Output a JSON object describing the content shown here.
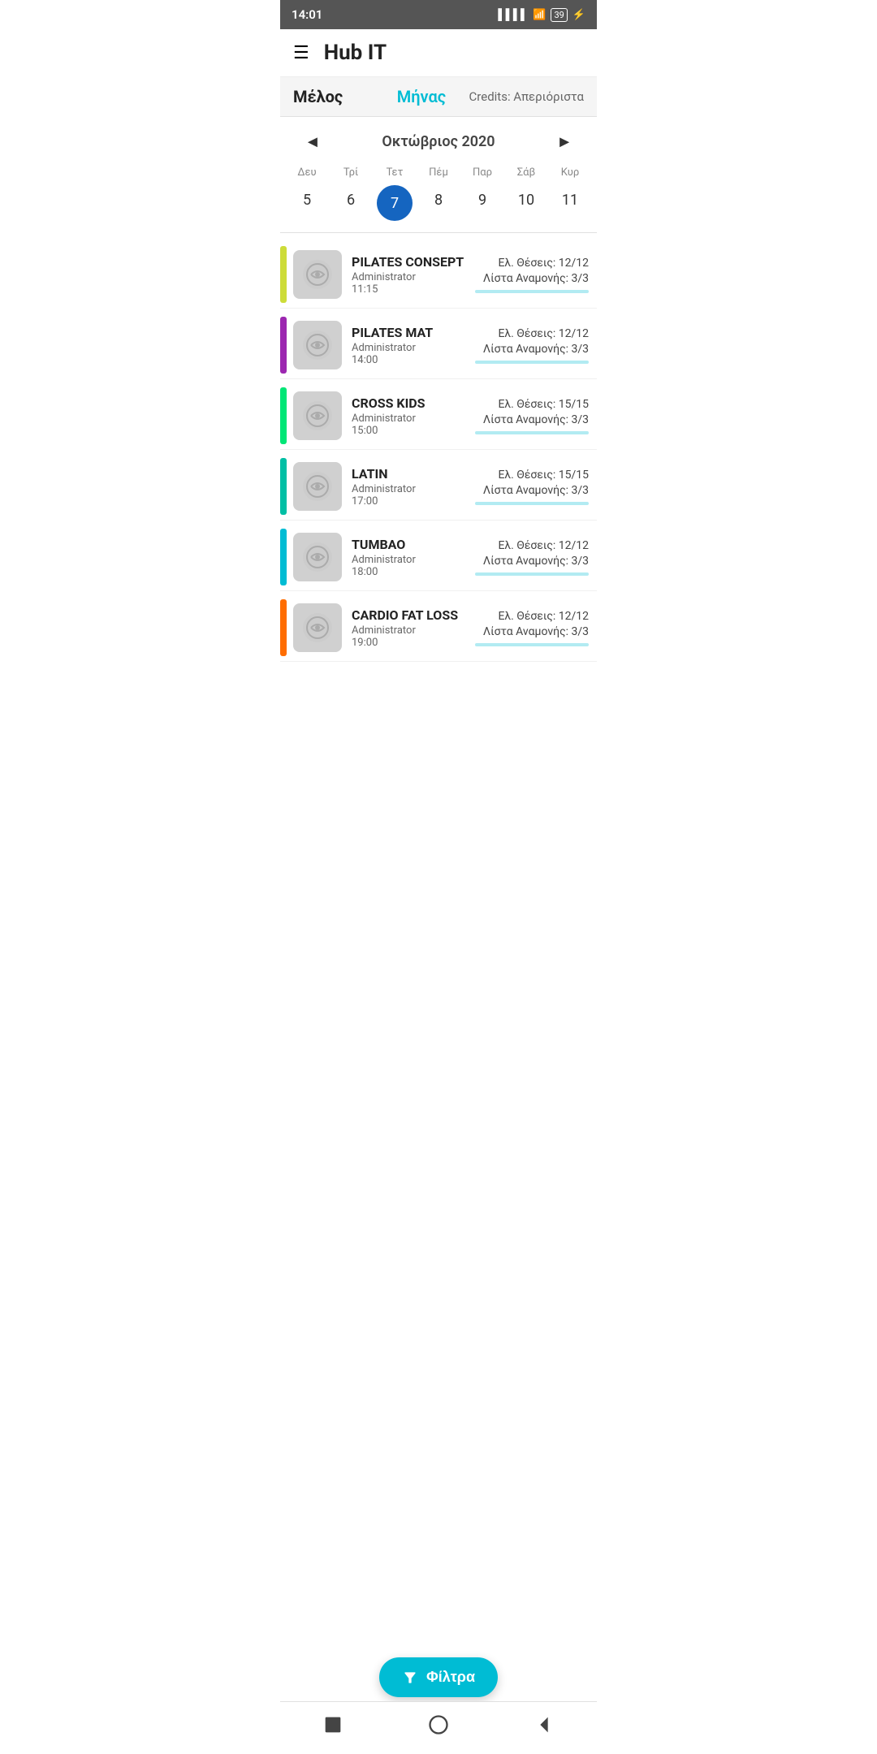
{
  "statusBar": {
    "time": "14:01",
    "battery": "39"
  },
  "header": {
    "title": "Hub IT"
  },
  "subHeader": {
    "melos": "Μέλος",
    "minas": "Μήνας",
    "credits": "Credits: Απεριόριστα"
  },
  "calendar": {
    "prevArrow": "◄",
    "nextArrow": "►",
    "month": "Οκτώβριος 2020",
    "dayHeaders": [
      "Δευ",
      "Τρί",
      "Τετ",
      "Πέμ",
      "Παρ",
      "Σάβ",
      "Κυρ"
    ],
    "days": [
      {
        "num": "5",
        "selected": false
      },
      {
        "num": "6",
        "selected": false
      },
      {
        "num": "7",
        "selected": true
      },
      {
        "num": "8",
        "selected": false
      },
      {
        "num": "9",
        "selected": false
      },
      {
        "num": "10",
        "selected": false
      },
      {
        "num": "11",
        "selected": false
      }
    ]
  },
  "classes": [
    {
      "name": "PILATES CONSEPT",
      "admin": "Administrator",
      "time": "11:15",
      "slots": "Ελ. Θέσεις: 12/12",
      "waitlist": "Λίστα Αναμονής: 3/3",
      "color": "#cddc39"
    },
    {
      "name": "PILATES MAT",
      "admin": "Administrator",
      "time": "14:00",
      "slots": "Ελ. Θέσεις: 12/12",
      "waitlist": "Λίστα Αναμονής: 3/3",
      "color": "#9c27b0"
    },
    {
      "name": "CROSS KIDS",
      "admin": "Administrator",
      "time": "15:00",
      "slots": "Ελ. Θέσεις: 15/15",
      "waitlist": "Λίστα Αναμονής: 3/3",
      "color": "#00e676"
    },
    {
      "name": "LATIN",
      "admin": "Administrator",
      "time": "17:00",
      "slots": "Ελ. Θέσεις: 15/15",
      "waitlist": "Λίστα Αναμονής: 3/3",
      "color": "#00bfa5"
    },
    {
      "name": "TUMBAO",
      "admin": "Administrator",
      "time": "18:00",
      "slots": "Ελ. Θέσεις: 12/12",
      "waitlist": "Λίστα Αναμονής: 3/3",
      "color": "#00bcd4"
    },
    {
      "name": "CARDIO FAT LOSS",
      "admin": "Administrator",
      "time": "19:00",
      "slots": "Ελ. Θέσεις: 12/12",
      "waitlist": "Λίστα Αναμονής: 3/3",
      "color": "#ff6d00"
    }
  ],
  "fab": {
    "label": "Φίλτρα"
  },
  "bottomNav": {
    "stop": "■",
    "circle": "⬤",
    "back": "◄"
  }
}
